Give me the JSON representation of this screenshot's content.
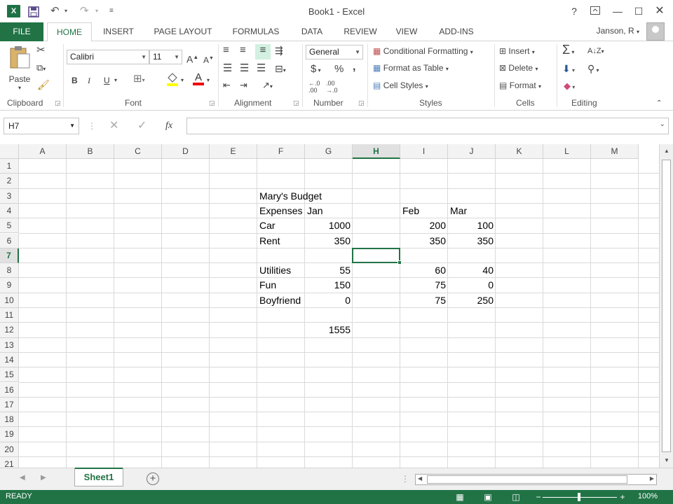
{
  "window": {
    "title": "Book1 - Excel",
    "app_icon": "X",
    "help": "?",
    "user": "Janson, R"
  },
  "tabs": [
    "FILE",
    "HOME",
    "INSERT",
    "PAGE LAYOUT",
    "FORMULAS",
    "DATA",
    "REVIEW",
    "VIEW",
    "ADD-INS"
  ],
  "active_tab": "HOME",
  "ribbon": {
    "clipboard": {
      "label": "Clipboard",
      "paste": "Paste"
    },
    "font": {
      "label": "Font",
      "family": "Calibri",
      "size": "11",
      "bold": "B",
      "italic": "I",
      "underline": "U",
      "grow": "A",
      "shrink": "A",
      "font_color": "A"
    },
    "alignment": {
      "label": "Alignment"
    },
    "number": {
      "label": "Number",
      "format": "General",
      "currency": "$",
      "percent": "%",
      "comma": ","
    },
    "styles": {
      "label": "Styles",
      "conditional": "Conditional Formatting",
      "format_table": "Format as Table",
      "cell_styles": "Cell Styles"
    },
    "cells": {
      "label": "Cells",
      "insert": "Insert",
      "delete": "Delete",
      "format": "Format"
    },
    "editing": {
      "label": "Editing",
      "sum": "Σ"
    }
  },
  "formula_bar": {
    "name_box": "H7",
    "fx": "fx",
    "value": ""
  },
  "columns": [
    "A",
    "B",
    "C",
    "D",
    "E",
    "F",
    "G",
    "H",
    "I",
    "J",
    "K",
    "L",
    "M"
  ],
  "active_column": "H",
  "rows": [
    "1",
    "2",
    "3",
    "4",
    "5",
    "6",
    "7",
    "8",
    "9",
    "10",
    "11",
    "12",
    "13",
    "14",
    "15",
    "16",
    "17",
    "18",
    "19",
    "20",
    "21"
  ],
  "active_row": "7",
  "cells": [
    {
      "ref": "F3",
      "value": "Mary's Budget",
      "align": "left"
    },
    {
      "ref": "F4",
      "value": "Expenses",
      "align": "left"
    },
    {
      "ref": "G4",
      "value": "Jan",
      "align": "left"
    },
    {
      "ref": "I4",
      "value": "Feb",
      "align": "left"
    },
    {
      "ref": "J4",
      "value": "Mar",
      "align": "left"
    },
    {
      "ref": "F5",
      "value": "Car",
      "align": "left"
    },
    {
      "ref": "G5",
      "value": "1000",
      "align": "right"
    },
    {
      "ref": "I5",
      "value": "200",
      "align": "right"
    },
    {
      "ref": "J5",
      "value": "100",
      "align": "right"
    },
    {
      "ref": "F6",
      "value": "Rent",
      "align": "left"
    },
    {
      "ref": "G6",
      "value": "350",
      "align": "right"
    },
    {
      "ref": "I6",
      "value": "350",
      "align": "right"
    },
    {
      "ref": "J6",
      "value": "350",
      "align": "right"
    },
    {
      "ref": "F8",
      "value": "Utilities",
      "align": "left"
    },
    {
      "ref": "G8",
      "value": "55",
      "align": "right"
    },
    {
      "ref": "I8",
      "value": "60",
      "align": "right"
    },
    {
      "ref": "J8",
      "value": "40",
      "align": "right"
    },
    {
      "ref": "F9",
      "value": "Fun",
      "align": "left"
    },
    {
      "ref": "G9",
      "value": "150",
      "align": "right"
    },
    {
      "ref": "I9",
      "value": "75",
      "align": "right"
    },
    {
      "ref": "J9",
      "value": "0",
      "align": "right"
    },
    {
      "ref": "F10",
      "value": "Boyfriend",
      "align": "left"
    },
    {
      "ref": "G10",
      "value": "0",
      "align": "right"
    },
    {
      "ref": "I10",
      "value": "75",
      "align": "right"
    },
    {
      "ref": "J10",
      "value": "250",
      "align": "right"
    },
    {
      "ref": "G12",
      "value": "1555",
      "align": "right"
    }
  ],
  "selected_cell": "H7",
  "sheets": [
    "Sheet1"
  ],
  "status": {
    "mode": "READY",
    "zoom": "100%"
  },
  "colors": {
    "accent": "#217346"
  }
}
